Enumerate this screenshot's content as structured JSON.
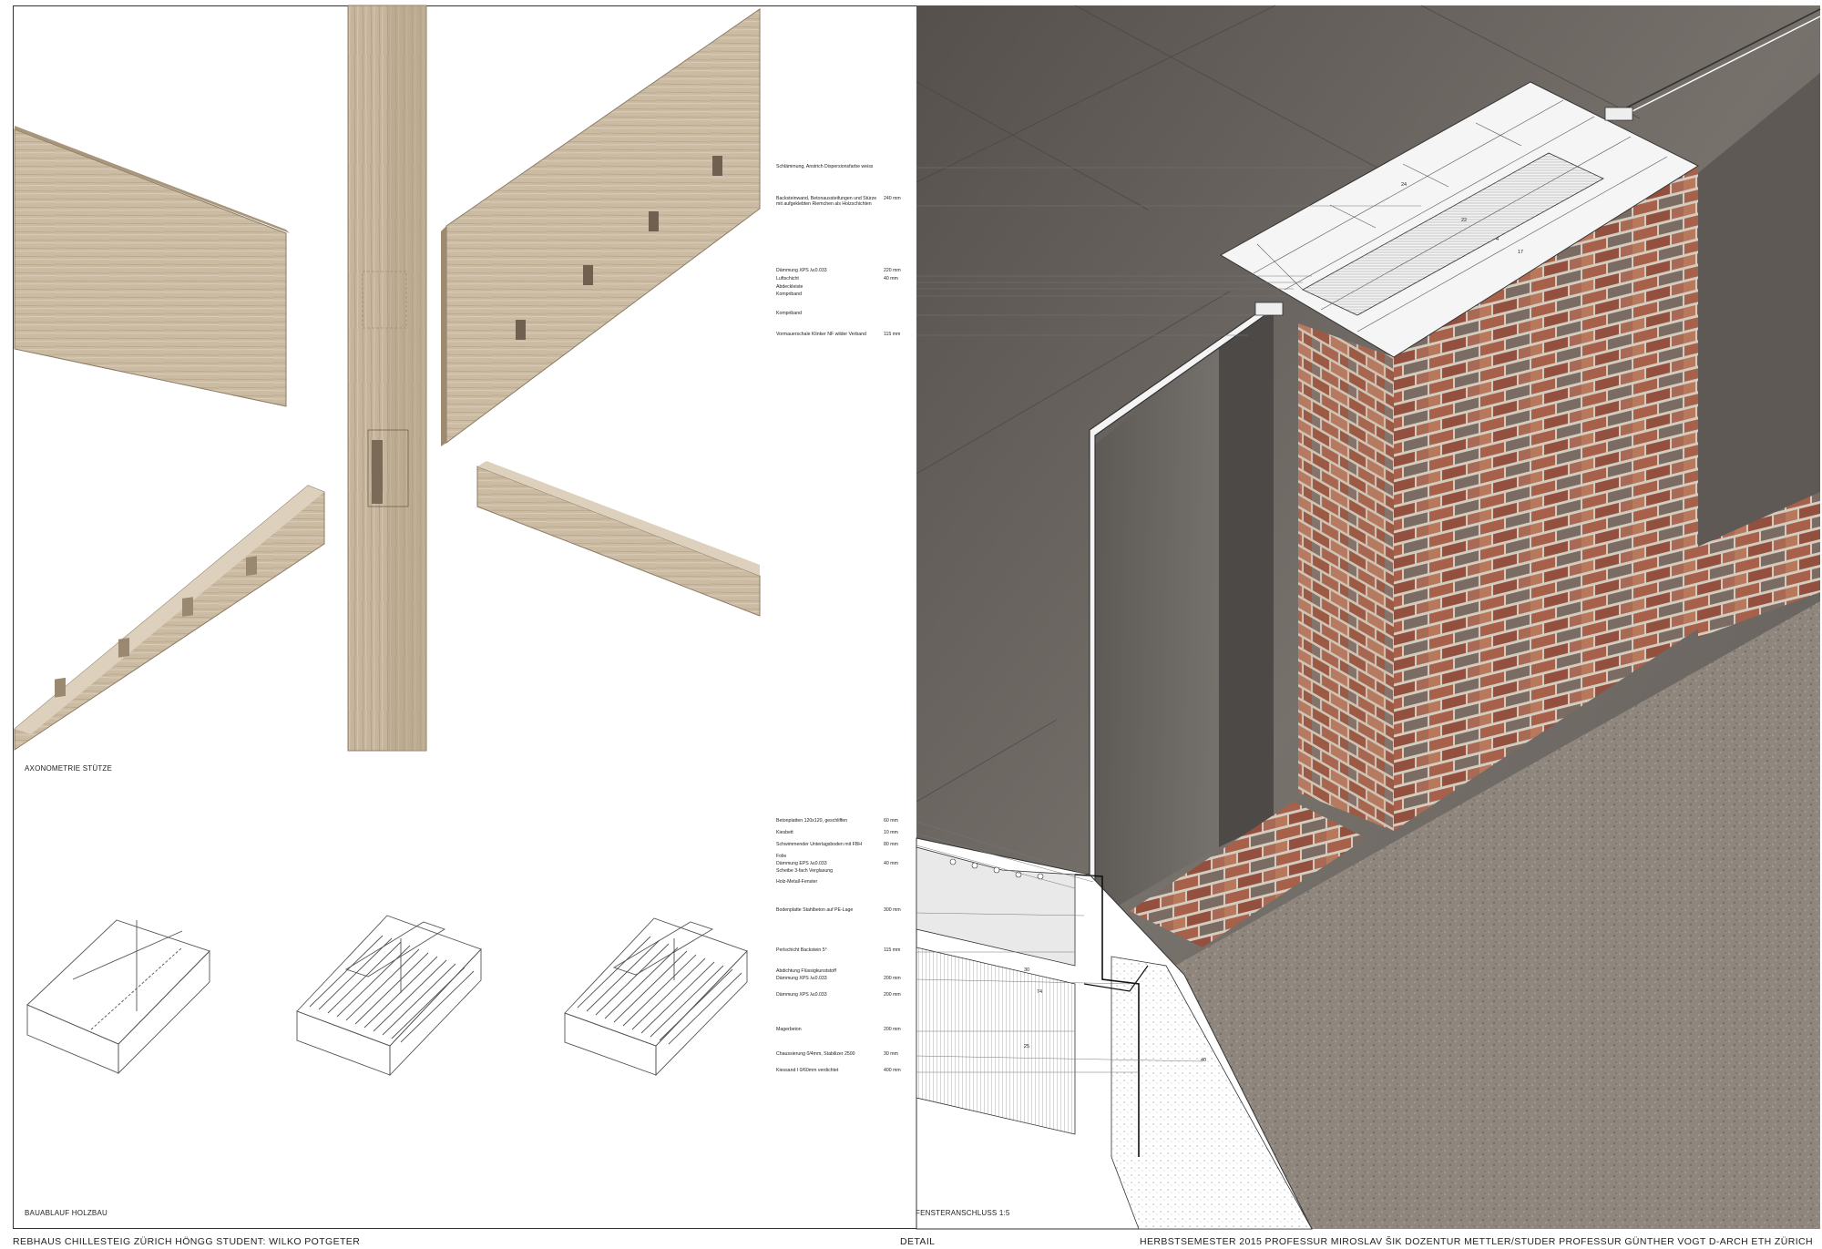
{
  "captions": {
    "axonometry": "AXONOMETRIE STÜTZE",
    "construction_sequence": "BAUABLAUF HOLZBAU",
    "window_detail": "FENSTERANSCHLUSS 1:5"
  },
  "footer": {
    "left": "REBHAUS CHILLESTEIG ZÜRICH HÖNGG   STUDENT: WILKO POTGETER",
    "center": "DETAIL",
    "right": "HERBSTSEMESTER 2015   PROFESSUR MIROSLAV ŠIK   DOZENTUR METTLER/STUDER   PROFESSUR GÜNTHER VOGT   D-ARCH   ETH ZÜRICH"
  },
  "annotations_top": [
    {
      "label": "Schlämmung, Anstrich Dispersionsfarbe weiss",
      "value": ""
    },
    {
      "label": "Backsteinwand, Betonaussteifungen und Stürze",
      "value": "240 mm"
    },
    {
      "label": "mit aufgeklebten Riemchen als Holzschichten",
      "value": ""
    },
    {
      "label": "Dämmung XPS λ≤0.033",
      "value": "220 mm"
    },
    {
      "label": "Luftschicht",
      "value": "40 mm"
    },
    {
      "label": "Abdeckleiste",
      "value": ""
    },
    {
      "label": "Kompriband",
      "value": ""
    },
    {
      "label": "Kompriband",
      "value": ""
    },
    {
      "label": "Vormauerschale Klinker NF wilder Verband",
      "value": "115 mm"
    }
  ],
  "annotations_bottom": [
    {
      "label": "Betonplatten 120x120, geschliffen",
      "value": "60 mm"
    },
    {
      "label": "Kiesbett",
      "value": "10 mm"
    },
    {
      "label": "Schwimmender Unterlagsboden mit FBH",
      "value": "80 mm"
    },
    {
      "label": "Folie",
      "value": ""
    },
    {
      "label": "Dämmung EPS λ≤0.033",
      "value": "40 mm"
    },
    {
      "label": "Scheibe 3-fach Verglasung",
      "value": ""
    },
    {
      "label": "Holz-Metall-Fenster",
      "value": ""
    },
    {
      "label": "Bodenplatte Stahlbeton auf PE-Lage",
      "value": "300 mm"
    },
    {
      "label": "Perlschicht Backstein 5°",
      "value": "115 mm"
    },
    {
      "label": "Abdichtung Flüssigkunststoff",
      "value": ""
    },
    {
      "label": "Dämmung XPS λ≤0.033",
      "value": "200 mm"
    },
    {
      "label": "Dämmung XPS λ≤0.033",
      "value": "200 mm"
    },
    {
      "label": "Magerbeton",
      "value": "200 mm"
    },
    {
      "label": "Chaussierung 0/4mm, Stabilizer 2500",
      "value": "30 mm"
    },
    {
      "label": "Kiessand I 0/60mm verdichtet",
      "value": "400 mm"
    }
  ],
  "dimensions": [
    "24",
    "22",
    "17",
    "4",
    "30",
    "74",
    "25",
    "40"
  ],
  "colors": {
    "wood": "#c9b9a1",
    "wood_dark": "#a89479",
    "wood_light": "#ddd0bd",
    "brick": "#a5634a",
    "brick_dark": "#6e6560",
    "mortar": "#d9cfc2",
    "floor": "#6f6a66",
    "gravel": "#948b80",
    "line": "#333333"
  }
}
